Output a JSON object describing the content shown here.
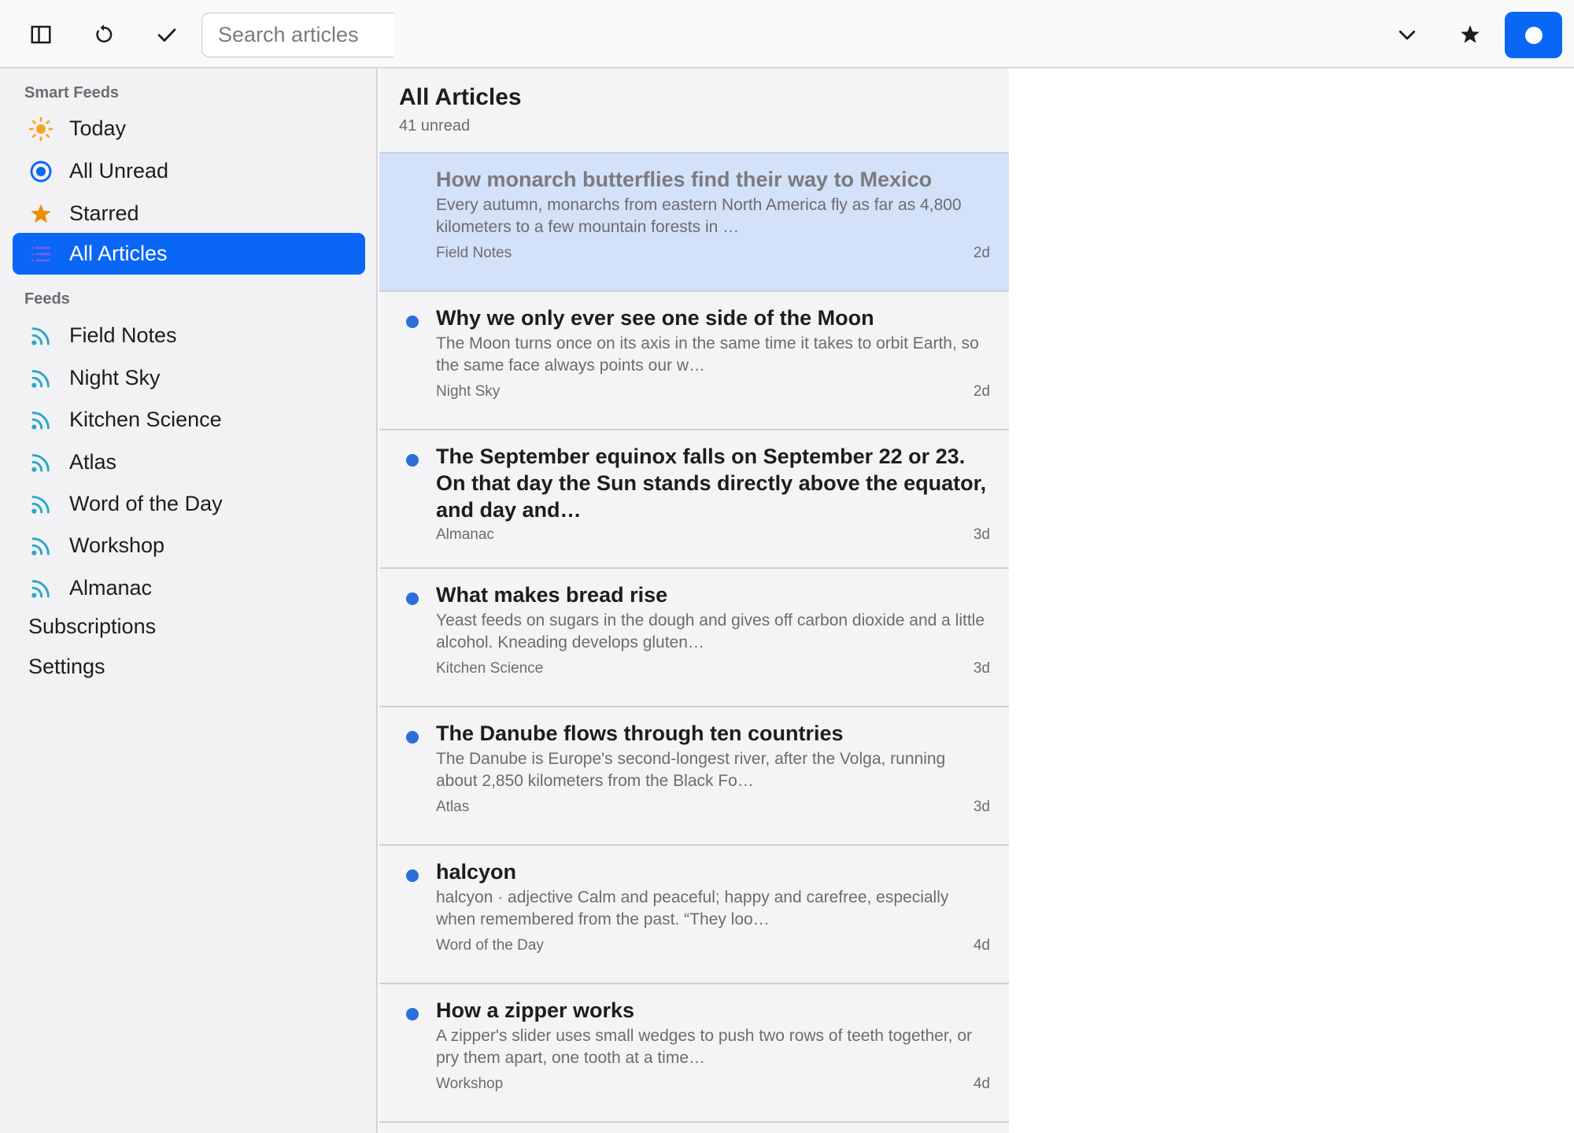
{
  "toolbar": {
    "search_placeholder": "Search articles",
    "icons": [
      "sidebar-toggle-icon",
      "refresh-icon",
      "checkmark-icon",
      "chevron-down-icon",
      "star-icon"
    ]
  },
  "sidebar": {
    "smart_feeds_title": "Smart Feeds",
    "smart_feeds": [
      {
        "label": "Today",
        "icon": "sun-icon"
      },
      {
        "label": "All Unread",
        "icon": "unread-circle-icon"
      },
      {
        "label": "Starred",
        "icon": "star-icon"
      },
      {
        "label": "All Articles",
        "icon": "list-icon",
        "active": true
      }
    ],
    "feeds_title": "Feeds",
    "feeds": [
      {
        "label": "Field Notes",
        "icon": "rss-icon"
      },
      {
        "label": "Night Sky",
        "icon": "rss-icon"
      },
      {
        "label": "Kitchen Science",
        "icon": "rss-icon"
      },
      {
        "label": "Atlas",
        "icon": "rss-icon"
      },
      {
        "label": "Word of the Day",
        "icon": "rss-icon"
      },
      {
        "label": "Workshop",
        "icon": "rss-icon"
      },
      {
        "label": "Almanac",
        "icon": "rss-icon"
      }
    ],
    "subscriptions": "Subscriptions",
    "settings": "Settings"
  },
  "list": {
    "title": "All Articles",
    "subtitle": "41 unread",
    "articles": [
      {
        "title": "How monarch butterflies find their way to Mexico",
        "snippet": "Every autumn, monarchs from eastern North America fly as far as 4,800 kilometers to a few mountain forests in …",
        "feed": "Field Notes",
        "age": "2d",
        "unread": false,
        "selected": true
      },
      {
        "title": "Why we only ever see one side of the Moon",
        "snippet": "The Moon turns once on its axis in the same time it takes to orbit Earth, so the same face always points our w…",
        "feed": "Night Sky",
        "age": "2d",
        "unread": true
      },
      {
        "title": "The September equinox falls on September 22 or 23. On that day the Sun stands directly above the equator, and day and…",
        "snippet": "",
        "feed": "Almanac",
        "age": "3d",
        "unread": true,
        "long": true
      },
      {
        "title": "What makes bread rise",
        "snippet": "Yeast feeds on sugars in the dough and gives off carbon dioxide and a little alcohol. Kneading develops gluten…",
        "feed": "Kitchen Science",
        "age": "3d",
        "unread": true
      },
      {
        "title": "The Danube flows through ten countries",
        "snippet": "The Danube is Europe's second-longest river, after the Volga, running about 2,850 kilometers from the Black Fo…",
        "feed": "Atlas",
        "age": "3d",
        "unread": true
      },
      {
        "title": "halcyon",
        "snippet": "halcyon · adjective Calm and peaceful; happy and carefree, especially when remembered from the past. “They loo…",
        "feed": "Word of the Day",
        "age": "4d",
        "unread": true
      },
      {
        "title": "How a zipper works",
        "snippet": "A zipper's slider uses small wedges to push two rows of teeth together, or pry them apart, one tooth at a time…",
        "feed": "Workshop",
        "age": "4d",
        "unread": true
      }
    ]
  },
  "colors": {
    "accent": "#0a66f5",
    "unread_dot": "#2b6fd8",
    "selected_row": "#d3e1f9",
    "sun": "#f5a623",
    "star": "#f08c00",
    "rss": "#2aa7c9"
  }
}
